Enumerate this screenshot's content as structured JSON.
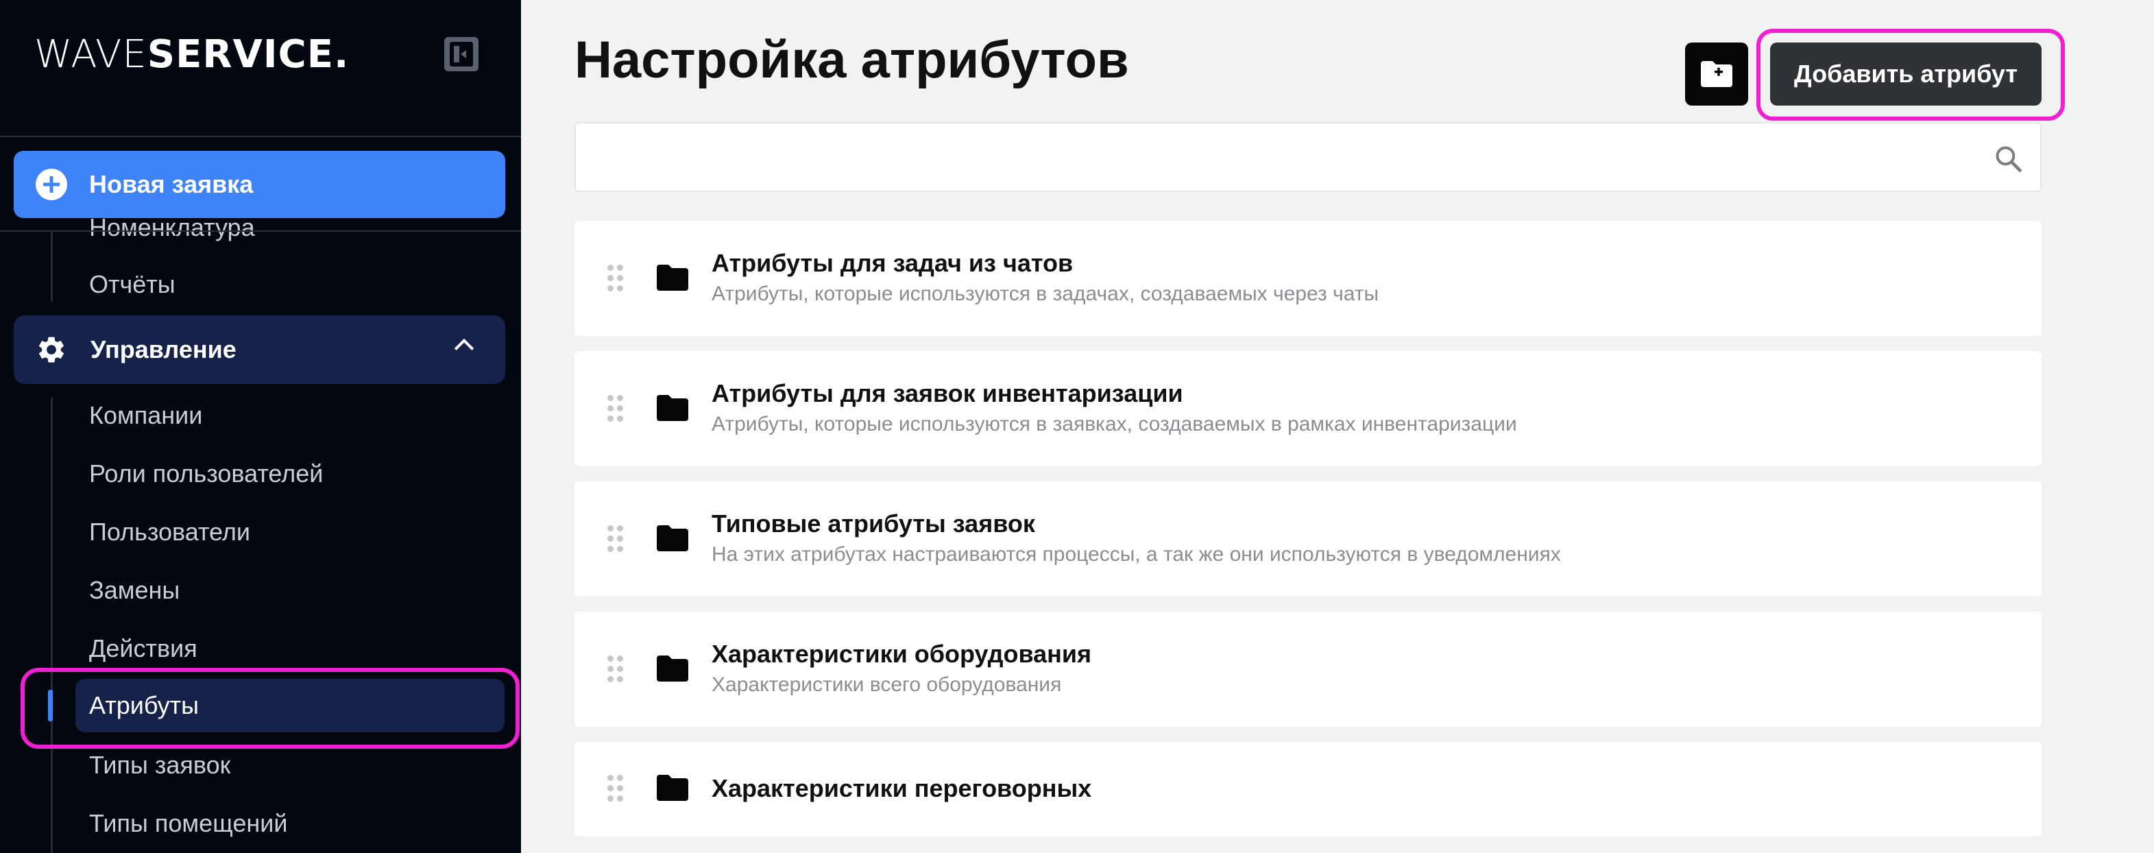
{
  "app": {
    "logo_light": "WAVE",
    "logo_bold": "SERVICE."
  },
  "sidebar": {
    "new_request_label": "Новая заявка",
    "items_above": [
      {
        "label": "Номенклатура"
      },
      {
        "label": "Отчёты"
      }
    ],
    "section_label": "Управление",
    "section_items": [
      {
        "label": "Компании"
      },
      {
        "label": "Роли пользователей"
      },
      {
        "label": "Пользователи"
      },
      {
        "label": "Замены"
      },
      {
        "label": "Действия"
      },
      {
        "label": "Атрибуты",
        "active": true
      },
      {
        "label": "Типы заявок"
      },
      {
        "label": "Типы помещений"
      }
    ]
  },
  "main": {
    "title": "Настройка атрибутов",
    "add_button_label": "Добавить атрибут",
    "search": {
      "value": "",
      "placeholder": ""
    },
    "groups": [
      {
        "title": "Атрибуты для задач из чатов",
        "description": "Атрибуты, которые используются в задачах, создаваемых через чаты"
      },
      {
        "title": "Атрибуты для заявок инвентаризации",
        "description": "Атрибуты, которые используются в заявках, создаваемых в рамках инвентаризации"
      },
      {
        "title": "Типовые атрибуты заявок",
        "description": "На этих атрибутах настраиваются процессы, а так же они используются в уведомлениях"
      },
      {
        "title": "Характеристики оборудования",
        "description": "Характеристики всего оборудования"
      },
      {
        "title": "Характеристики переговорных",
        "description": ""
      }
    ]
  },
  "colors": {
    "sidebar_bg": "#03070f",
    "accent_blue": "#3e84f8",
    "active_bg": "#16224a",
    "highlight": "#f01fd1",
    "main_bg": "#f1f2f2"
  },
  "icons": [
    "collapse-sidebar-icon",
    "plus-circle-icon",
    "gear-icon",
    "chevron-up-icon",
    "folder-add-icon",
    "search-icon",
    "drag-handle-icon",
    "folder-icon"
  ]
}
